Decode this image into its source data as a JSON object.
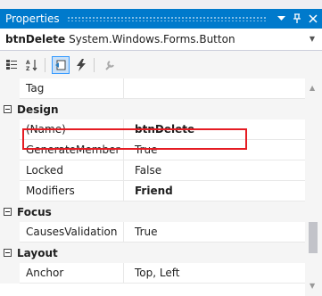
{
  "panel": {
    "title": "Properties",
    "pin_icon": "pin-icon",
    "close_icon": "close-icon",
    "menu_icon": "dropdown-arrow-icon"
  },
  "selector": {
    "object_name": "btnDelete",
    "object_type": "System.Windows.Forms.Button"
  },
  "toolbar": {
    "tools": [
      "categorized-icon",
      "alphabetical-icon",
      "properties-icon",
      "events-icon",
      "property-pages-icon"
    ]
  },
  "grid": {
    "rows": [
      {
        "kind": "prop",
        "name": "Tag",
        "value": ""
      },
      {
        "kind": "category",
        "name": "Design"
      },
      {
        "kind": "prop",
        "name": "(Name)",
        "value": "btnDelete",
        "bold": true
      },
      {
        "kind": "prop",
        "name": "GenerateMember",
        "value": "True"
      },
      {
        "kind": "prop",
        "name": "Locked",
        "value": "False"
      },
      {
        "kind": "prop",
        "name": "Modifiers",
        "value": "Friend",
        "bold": true
      },
      {
        "kind": "category",
        "name": "Focus"
      },
      {
        "kind": "prop",
        "name": "CausesValidation",
        "value": "True"
      },
      {
        "kind": "category",
        "name": "Layout"
      },
      {
        "kind": "prop",
        "name": "Anchor",
        "value": "Top, Left"
      }
    ]
  },
  "colors": {
    "accent": "#007acc",
    "highlight": "#e51c23"
  }
}
